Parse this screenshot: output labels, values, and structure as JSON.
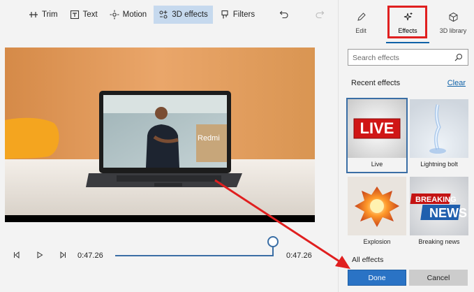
{
  "toolbar": {
    "trim": "Trim",
    "text": "Text",
    "motion": "Motion",
    "effects_3d": "3D effects",
    "filters": "Filters",
    "undo_icon": "undo-icon",
    "redo_icon": "redo-icon"
  },
  "player": {
    "laptop_text": "Redmi"
  },
  "playback": {
    "current_time": "0:47.26",
    "end_time": "0:47.26",
    "progress": 1.0
  },
  "panel": {
    "tabs": [
      {
        "label": "Edit",
        "icon": "pencil-icon"
      },
      {
        "label": "Effects",
        "icon": "sparkle-icon",
        "selected": true
      },
      {
        "label": "3D library",
        "icon": "cube-icon"
      }
    ],
    "search_placeholder": "Search effects",
    "recent_title": "Recent effects",
    "clear_label": "Clear",
    "effects": [
      {
        "label": "Live",
        "thumb_text": "LIVE",
        "selected": true
      },
      {
        "label": "Lightning bolt"
      },
      {
        "label": "Explosion"
      },
      {
        "label": "Breaking news",
        "thumb_text_1": "BREAKING",
        "thumb_text_2": "NEWS"
      }
    ],
    "all_effects_label": "All effects",
    "done_label": "Done",
    "cancel_label": "Cancel"
  },
  "colors": {
    "accent": "#2a73c5",
    "annotation_red": "#e01f1f",
    "selected_tab_bg": "#c6d9ee"
  }
}
